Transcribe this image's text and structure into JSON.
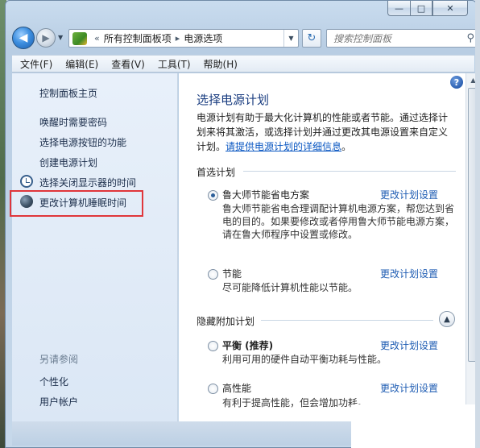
{
  "window": {
    "caption_min": "—",
    "caption_max": "□",
    "caption_close": "✕"
  },
  "nav": {
    "back_glyph": "◀",
    "forward_glyph": "▶",
    "address_sep1": "«",
    "address_crumb1": "所有控制面板项",
    "address_sep2": "▸",
    "address_crumb2": "电源选项",
    "search_placeholder": "搜索控制面板",
    "refresh_glyph": "↻",
    "search_glyph": "⚲"
  },
  "menu": {
    "file": "文件(F)",
    "edit": "编辑(E)",
    "view": "查看(V)",
    "tools": "工具(T)",
    "help": "帮助(H)"
  },
  "sidebar": {
    "home": "控制面板主页",
    "links": [
      "唤醒时需要密码",
      "选择电源按钮的功能",
      "创建电源计划",
      "选择关闭显示器的时间",
      "更改计算机睡眠时间"
    ],
    "see_also_title": "另请参阅",
    "see_also_links": [
      "个性化",
      "用户帐户"
    ]
  },
  "main": {
    "help_glyph": "?",
    "title": "选择电源计划",
    "intro_text": "电源计划有助于最大化计算机的性能或者节能。通过选择计划来将其激活，或选择计划并通过更改其电源设置来自定义计划。",
    "intro_link": "请提供电源计划的详细信息",
    "intro_tail": "。",
    "preferred_title": "首选计划",
    "hidden_title": "隐藏附加计划",
    "change_link": "更改计划设置",
    "plans": [
      {
        "name": "鲁大师节能省电方案",
        "desc": "鲁大师节能省电合理调配计算机电源方案，帮您达到省电的目的。如果要修改或者停用鲁大师节能电源方案，请在鲁大师程序中设置或修改。",
        "checked": true
      },
      {
        "name": "节能",
        "desc": "尽可能降低计算机性能以节能。",
        "checked": false
      },
      {
        "name": "平衡 (推荐)",
        "desc": "利用可用的硬件自动平衡功耗与性能。",
        "checked": false
      },
      {
        "name": "高性能",
        "desc": "有利于提高性能，但会增加功耗。",
        "checked": false
      }
    ]
  }
}
